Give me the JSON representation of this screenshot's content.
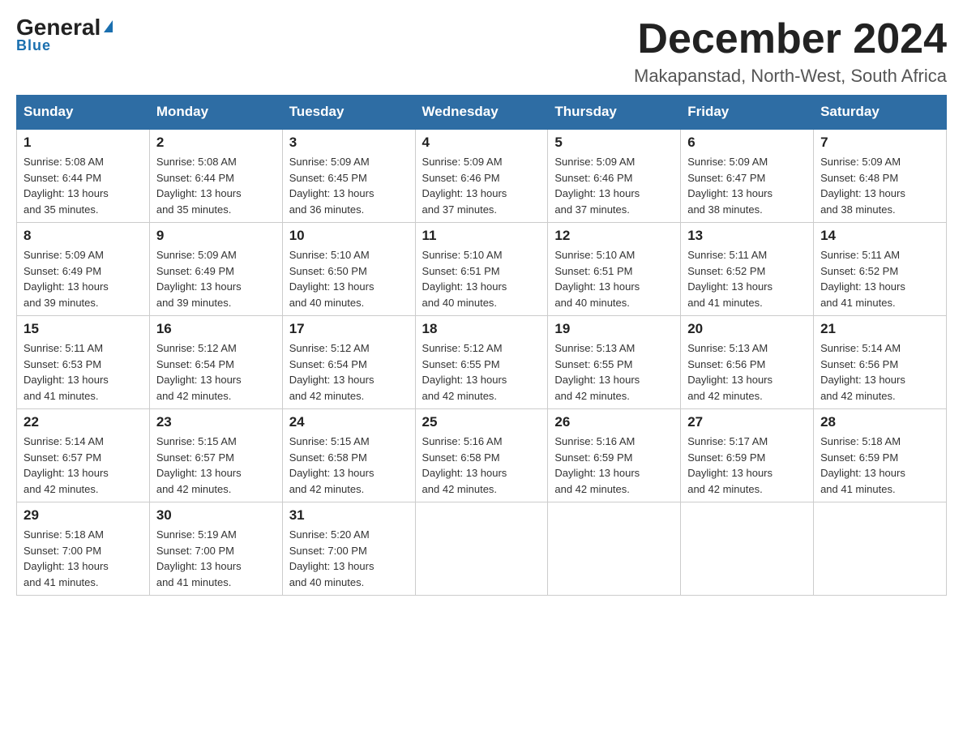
{
  "logo": {
    "general": "General",
    "blue": "Blue",
    "triangle": "▶"
  },
  "header": {
    "title": "December 2024",
    "subtitle": "Makapanstad, North-West, South Africa"
  },
  "weekdays": [
    "Sunday",
    "Monday",
    "Tuesday",
    "Wednesday",
    "Thursday",
    "Friday",
    "Saturday"
  ],
  "weeks": [
    [
      {
        "day": "1",
        "sunrise": "5:08 AM",
        "sunset": "6:44 PM",
        "daylight": "13 hours and 35 minutes."
      },
      {
        "day": "2",
        "sunrise": "5:08 AM",
        "sunset": "6:44 PM",
        "daylight": "13 hours and 35 minutes."
      },
      {
        "day": "3",
        "sunrise": "5:09 AM",
        "sunset": "6:45 PM",
        "daylight": "13 hours and 36 minutes."
      },
      {
        "day": "4",
        "sunrise": "5:09 AM",
        "sunset": "6:46 PM",
        "daylight": "13 hours and 37 minutes."
      },
      {
        "day": "5",
        "sunrise": "5:09 AM",
        "sunset": "6:46 PM",
        "daylight": "13 hours and 37 minutes."
      },
      {
        "day": "6",
        "sunrise": "5:09 AM",
        "sunset": "6:47 PM",
        "daylight": "13 hours and 38 minutes."
      },
      {
        "day": "7",
        "sunrise": "5:09 AM",
        "sunset": "6:48 PM",
        "daylight": "13 hours and 38 minutes."
      }
    ],
    [
      {
        "day": "8",
        "sunrise": "5:09 AM",
        "sunset": "6:49 PM",
        "daylight": "13 hours and 39 minutes."
      },
      {
        "day": "9",
        "sunrise": "5:09 AM",
        "sunset": "6:49 PM",
        "daylight": "13 hours and 39 minutes."
      },
      {
        "day": "10",
        "sunrise": "5:10 AM",
        "sunset": "6:50 PM",
        "daylight": "13 hours and 40 minutes."
      },
      {
        "day": "11",
        "sunrise": "5:10 AM",
        "sunset": "6:51 PM",
        "daylight": "13 hours and 40 minutes."
      },
      {
        "day": "12",
        "sunrise": "5:10 AM",
        "sunset": "6:51 PM",
        "daylight": "13 hours and 40 minutes."
      },
      {
        "day": "13",
        "sunrise": "5:11 AM",
        "sunset": "6:52 PM",
        "daylight": "13 hours and 41 minutes."
      },
      {
        "day": "14",
        "sunrise": "5:11 AM",
        "sunset": "6:52 PM",
        "daylight": "13 hours and 41 minutes."
      }
    ],
    [
      {
        "day": "15",
        "sunrise": "5:11 AM",
        "sunset": "6:53 PM",
        "daylight": "13 hours and 41 minutes."
      },
      {
        "day": "16",
        "sunrise": "5:12 AM",
        "sunset": "6:54 PM",
        "daylight": "13 hours and 42 minutes."
      },
      {
        "day": "17",
        "sunrise": "5:12 AM",
        "sunset": "6:54 PM",
        "daylight": "13 hours and 42 minutes."
      },
      {
        "day": "18",
        "sunrise": "5:12 AM",
        "sunset": "6:55 PM",
        "daylight": "13 hours and 42 minutes."
      },
      {
        "day": "19",
        "sunrise": "5:13 AM",
        "sunset": "6:55 PM",
        "daylight": "13 hours and 42 minutes."
      },
      {
        "day": "20",
        "sunrise": "5:13 AM",
        "sunset": "6:56 PM",
        "daylight": "13 hours and 42 minutes."
      },
      {
        "day": "21",
        "sunrise": "5:14 AM",
        "sunset": "6:56 PM",
        "daylight": "13 hours and 42 minutes."
      }
    ],
    [
      {
        "day": "22",
        "sunrise": "5:14 AM",
        "sunset": "6:57 PM",
        "daylight": "13 hours and 42 minutes."
      },
      {
        "day": "23",
        "sunrise": "5:15 AM",
        "sunset": "6:57 PM",
        "daylight": "13 hours and 42 minutes."
      },
      {
        "day": "24",
        "sunrise": "5:15 AM",
        "sunset": "6:58 PM",
        "daylight": "13 hours and 42 minutes."
      },
      {
        "day": "25",
        "sunrise": "5:16 AM",
        "sunset": "6:58 PM",
        "daylight": "13 hours and 42 minutes."
      },
      {
        "day": "26",
        "sunrise": "5:16 AM",
        "sunset": "6:59 PM",
        "daylight": "13 hours and 42 minutes."
      },
      {
        "day": "27",
        "sunrise": "5:17 AM",
        "sunset": "6:59 PM",
        "daylight": "13 hours and 42 minutes."
      },
      {
        "day": "28",
        "sunrise": "5:18 AM",
        "sunset": "6:59 PM",
        "daylight": "13 hours and 41 minutes."
      }
    ],
    [
      {
        "day": "29",
        "sunrise": "5:18 AM",
        "sunset": "7:00 PM",
        "daylight": "13 hours and 41 minutes."
      },
      {
        "day": "30",
        "sunrise": "5:19 AM",
        "sunset": "7:00 PM",
        "daylight": "13 hours and 41 minutes."
      },
      {
        "day": "31",
        "sunrise": "5:20 AM",
        "sunset": "7:00 PM",
        "daylight": "13 hours and 40 minutes."
      },
      null,
      null,
      null,
      null
    ]
  ],
  "labels": {
    "sunrise": "Sunrise:",
    "sunset": "Sunset:",
    "daylight": "Daylight:"
  }
}
